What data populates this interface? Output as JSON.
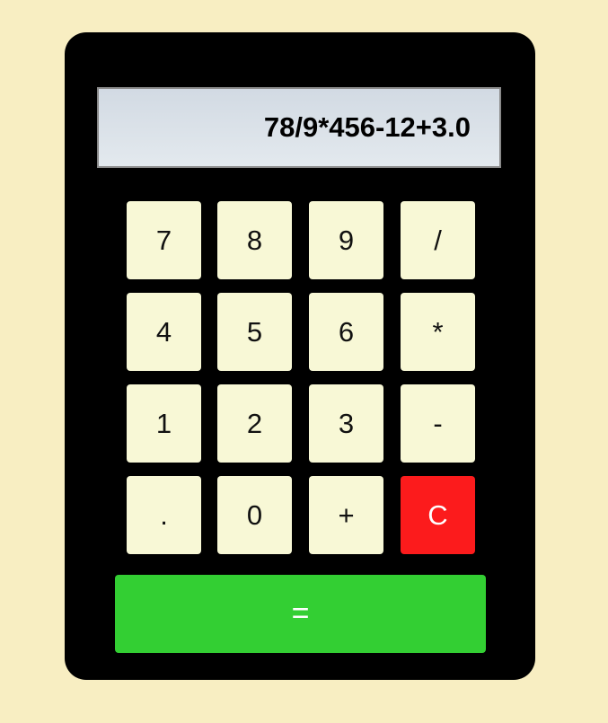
{
  "display": {
    "expression": "78/9*456-12+3.0"
  },
  "keys": {
    "k7": "7",
    "k8": "8",
    "k9": "9",
    "divide": "/",
    "k4": "4",
    "k5": "5",
    "k6": "6",
    "multiply": "*",
    "k1": "1",
    "k2": "2",
    "k3": "3",
    "subtract": "-",
    "decimal": ".",
    "k0": "0",
    "add": "+",
    "clear": "C",
    "equals": "="
  },
  "colors": {
    "page_background": "#f8eec2",
    "calculator_body": "#000000",
    "key_background": "#f8f8d6",
    "clear_key": "#fc1b1c",
    "equals_key": "#33cf33"
  }
}
